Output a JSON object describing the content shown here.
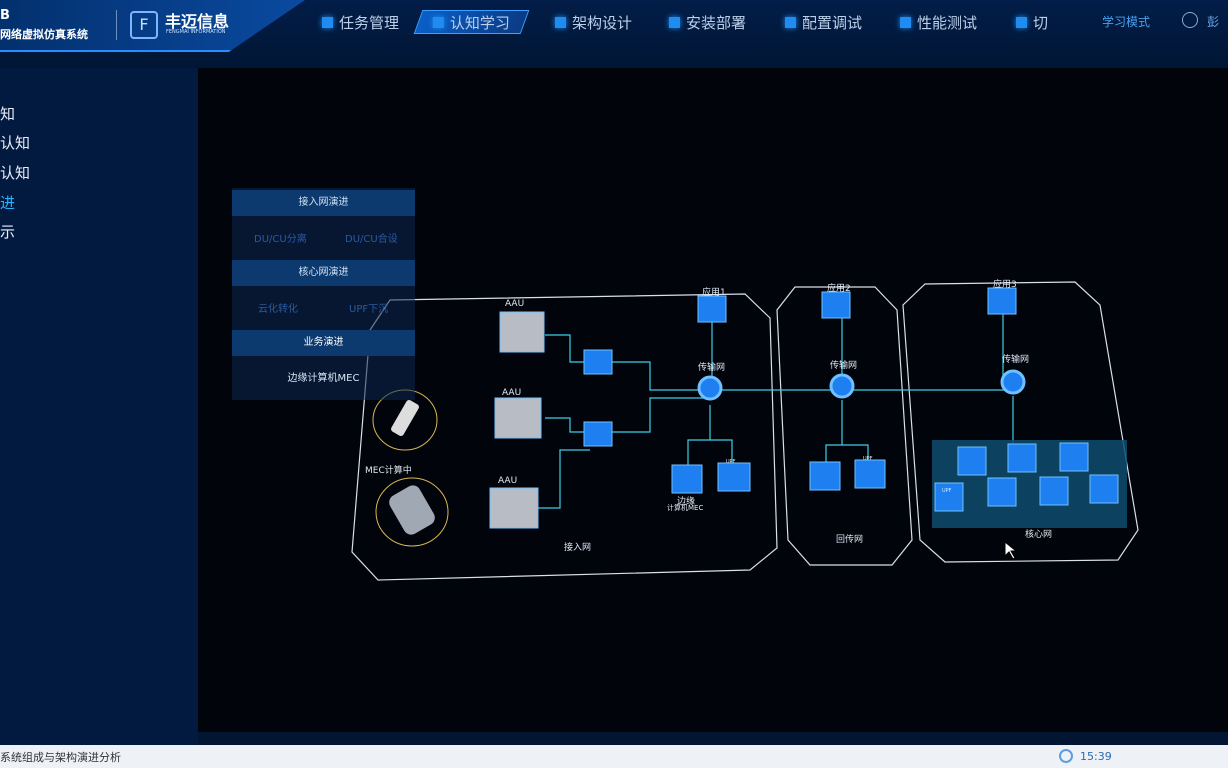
{
  "header": {
    "system_line1": "B",
    "system_line2": "网络虚拟仿真系统",
    "company": "丰迈信息",
    "company_en": "FENGMAI INFORMATION",
    "nav": [
      {
        "label": "任务管理"
      },
      {
        "label": "认知学习",
        "active": true
      },
      {
        "label": "架构设计"
      },
      {
        "label": "安装部署"
      },
      {
        "label": "配置调试"
      },
      {
        "label": "性能测试"
      },
      {
        "label": "切"
      }
    ],
    "mode": "学习模式",
    "user": "彭"
  },
  "sidebar": {
    "items": [
      {
        "label": "知"
      },
      {
        "label": "认知"
      },
      {
        "label": "认知"
      },
      {
        "label": "进",
        "selected": true
      },
      {
        "label": "示"
      }
    ]
  },
  "panel": {
    "sections": [
      {
        "title": "接入网演进",
        "options": [
          "DU/CU分离",
          "DU/CU合设"
        ]
      },
      {
        "title": "核心网演进",
        "options": [
          "云化转化",
          "UPF下沉"
        ]
      },
      {
        "title": "业务演进",
        "options": [
          "边缘计算机MEC"
        ]
      }
    ]
  },
  "diagram": {
    "aau": [
      "AAU",
      "AAU",
      "AAU"
    ],
    "apps": [
      "应用1",
      "应用2",
      "应用3"
    ],
    "transport": [
      "传输网",
      "传输网",
      "传输网"
    ],
    "mec_label": "MEC计算中",
    "edge_label1": "边缘",
    "edge_label2": "计算机MEC",
    "upf": "UPF",
    "zones": [
      "接入网",
      "回传网",
      "核心网"
    ]
  },
  "status": {
    "text": "系统组成与架构演进分析",
    "time": "15:39"
  },
  "colors": {
    "accent": "#25b6ff",
    "header": "#021d48",
    "stage": "#02040c"
  }
}
